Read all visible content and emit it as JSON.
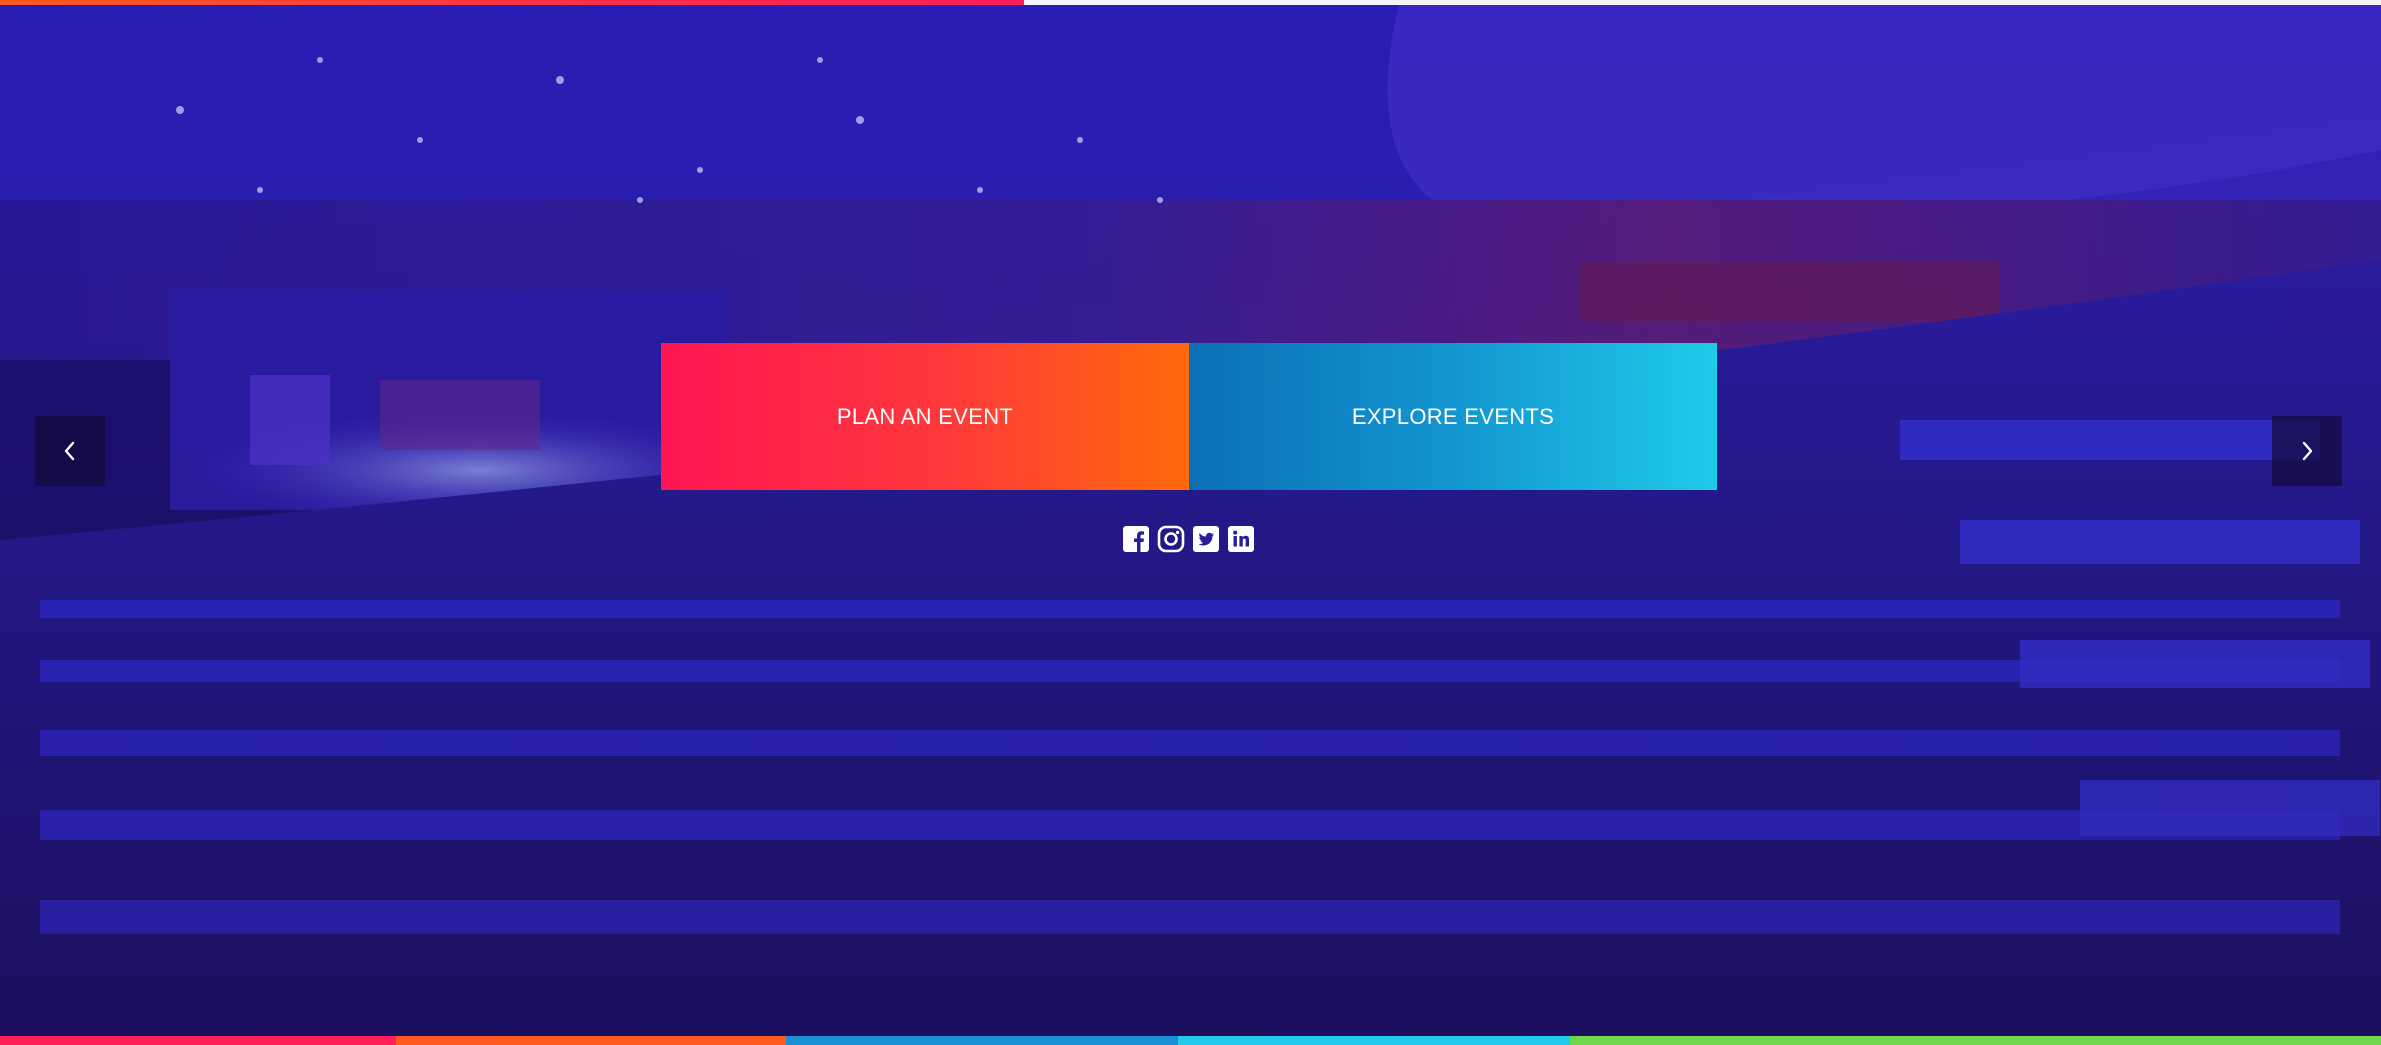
{
  "hero": {
    "plan_label": "PLAN AN EVENT",
    "explore_label": "EXPLORE EVENTS",
    "slider_progress": 0.43
  },
  "colors": {
    "plan_start": "#ff1553",
    "plan_end": "#ff6a0a",
    "explore_start": "#0b6fb7",
    "explore_end": "#1fcbe8",
    "bottom_bar": [
      "#ff1f5a",
      "#ff5a1f",
      "#1a8fd6",
      "#1fcbe8",
      "#6ed64a"
    ]
  },
  "icons": {
    "prev": "chevron-left-icon",
    "next": "chevron-right-icon",
    "social": [
      "facebook-icon",
      "instagram-icon",
      "twitter-icon",
      "linkedin-icon"
    ]
  }
}
